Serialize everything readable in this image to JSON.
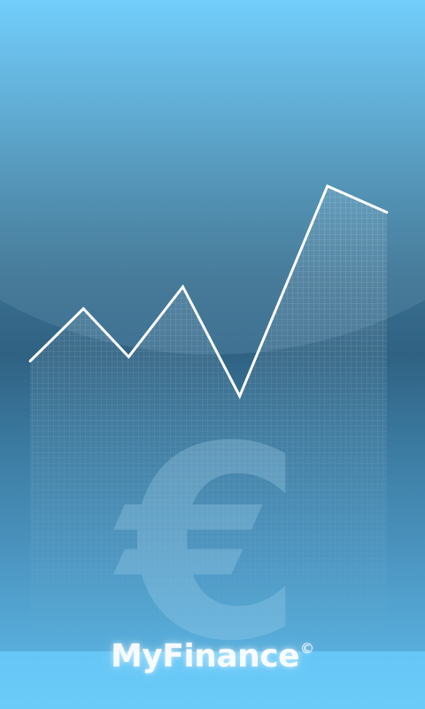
{
  "app": {
    "name": "MyFinance",
    "copyright_mark": "©"
  },
  "decoration": {
    "currency_symbol": "€",
    "currency_icon": "euro-icon"
  },
  "colors": {
    "sky_top": "#6fcdfb",
    "sky_mid": "#2f6283",
    "sky_bottom": "#63c0ef",
    "line": "#ffffff"
  },
  "chart_data": {
    "type": "line",
    "x": [
      1,
      2,
      3,
      4,
      5,
      6,
      7
    ],
    "values": [
      40,
      52,
      41,
      57,
      32,
      80,
      74
    ],
    "ylim": [
      0,
      100
    ],
    "grid": false
  }
}
